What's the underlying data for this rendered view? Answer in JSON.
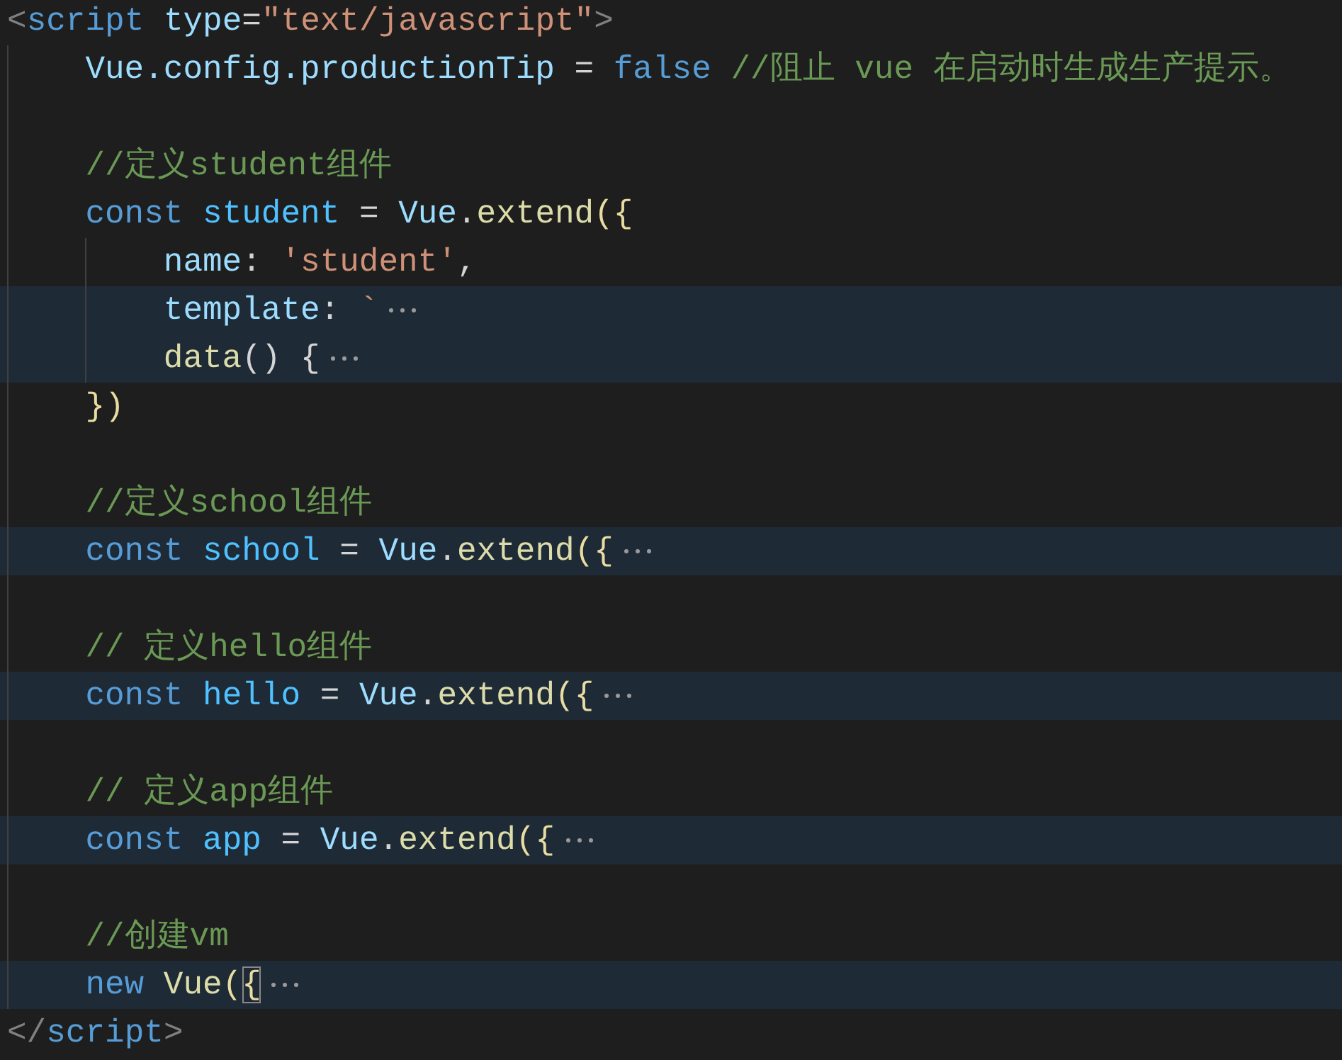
{
  "editor": {
    "lines": [
      {
        "tokens": [
          {
            "text": "<",
            "kind": "tag-punct"
          },
          {
            "text": "script ",
            "kind": "tag"
          },
          {
            "text": "type",
            "kind": "attr"
          },
          {
            "text": "=",
            "kind": "plain"
          },
          {
            "text": "\"text/javascript\"",
            "kind": "string"
          },
          {
            "text": ">",
            "kind": "tag-punct"
          }
        ],
        "children": [
          {
            "tokens": [
              {
                "text": "Vue.config.productionTip",
                "kind": "variable"
              },
              {
                "text": " = ",
                "kind": "plain"
              },
              {
                "text": "false",
                "kind": "keyword"
              },
              {
                "text": " //阻止 vue 在启动时生成生产提示。",
                "kind": "comment"
              }
            ]
          },
          {
            "indent_guide": true
          },
          {
            "tokens": [
              {
                "text": "//定义student组件",
                "kind": "comment"
              }
            ]
          },
          {
            "tokens": [
              {
                "text": "const ",
                "kind": "keyword"
              },
              {
                "text": "student",
                "kind": "constant"
              },
              {
                "text": " = ",
                "kind": "plain"
              },
              {
                "text": "Vue",
                "kind": "variable"
              },
              {
                "text": ".",
                "kind": "plain"
              },
              {
                "text": "extend",
                "kind": "function"
              },
              {
                "text": "({",
                "kind": "bracket"
              }
            ],
            "children": [
              {
                "tokens": [
                  {
                    "text": "name",
                    "kind": "variable"
                  },
                  {
                    "text": ": ",
                    "kind": "plain"
                  },
                  {
                    "text": "'student'",
                    "kind": "string"
                  },
                  {
                    "text": ",",
                    "kind": "plain"
                  }
                ]
              },
              {
                "tokens": [
                  {
                    "text": "template",
                    "kind": "variable"
                  },
                  {
                    "text": ": ",
                    "kind": "plain"
                  },
                  {
                    "text": "`",
                    "kind": "string"
                  }
                ],
                "folded": true
              },
              {
                "tokens": [
                  {
                    "text": "data",
                    "kind": "function"
                  },
                  {
                    "text": "() {",
                    "kind": "plain"
                  }
                ],
                "folded": true
              }
            ]
          },
          {
            "tokens": [
              {
                "text": "})",
                "kind": "bracket"
              }
            ]
          },
          {
            "indent_guide": true
          },
          {
            "tokens": [
              {
                "text": "//定义school组件",
                "kind": "comment"
              }
            ]
          },
          {
            "tokens": [
              {
                "text": "const ",
                "kind": "keyword"
              },
              {
                "text": "school",
                "kind": "constant"
              },
              {
                "text": " = ",
                "kind": "plain"
              },
              {
                "text": "Vue",
                "kind": "variable"
              },
              {
                "text": ".",
                "kind": "plain"
              },
              {
                "text": "extend",
                "kind": "function"
              },
              {
                "text": "({",
                "kind": "bracket"
              }
            ],
            "folded": true
          },
          {
            "indent_guide": true
          },
          {
            "tokens": [
              {
                "text": "// 定义hello组件",
                "kind": "comment"
              }
            ]
          },
          {
            "tokens": [
              {
                "text": "const ",
                "kind": "keyword"
              },
              {
                "text": "hello",
                "kind": "constant"
              },
              {
                "text": " = ",
                "kind": "plain"
              },
              {
                "text": "Vue",
                "kind": "variable"
              },
              {
                "text": ".",
                "kind": "plain"
              },
              {
                "text": "extend",
                "kind": "function"
              },
              {
                "text": "({",
                "kind": "bracket"
              }
            ],
            "folded": true
          },
          {
            "indent_guide": true
          },
          {
            "tokens": [
              {
                "text": "// 定义app组件",
                "kind": "comment"
              }
            ]
          },
          {
            "tokens": [
              {
                "text": "const ",
                "kind": "keyword"
              },
              {
                "text": "app",
                "kind": "constant"
              },
              {
                "text": " = ",
                "kind": "plain"
              },
              {
                "text": "Vue",
                "kind": "variable"
              },
              {
                "text": ".",
                "kind": "plain"
              },
              {
                "text": "extend",
                "kind": "function"
              },
              {
                "text": "({",
                "kind": "bracket"
              }
            ],
            "folded": true
          },
          {
            "indent_guide": true
          },
          {
            "tokens": [
              {
                "text": "//创建vm",
                "kind": "comment"
              }
            ]
          },
          {
            "tokens": [
              {
                "text": "new ",
                "kind": "keyword"
              },
              {
                "text": "Vue",
                "kind": "function"
              },
              {
                "text": "(",
                "kind": "bracket"
              },
              {
                "text": "{",
                "kind": "bracket",
                "matched": true
              }
            ],
            "folded": true
          }
        ]
      },
      {
        "tokens": [
          {
            "text": "</",
            "kind": "tag-punct"
          },
          {
            "text": "script",
            "kind": "tag"
          },
          {
            "text": ">",
            "kind": "tag-punct"
          }
        ]
      }
    ]
  }
}
